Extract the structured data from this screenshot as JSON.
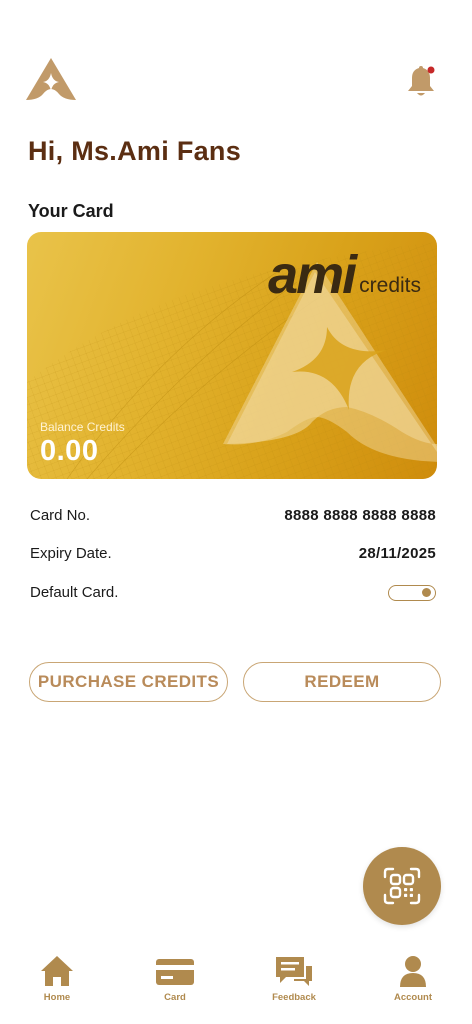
{
  "header": {
    "logo_icon": "ami-logo-icon",
    "notification_icon": "bell-icon",
    "notification_badge_color": "#c62828"
  },
  "greeting": "Hi, Ms.Ami Fans",
  "card_section": {
    "title": "Your Card"
  },
  "card": {
    "brand": "ami",
    "brand_suffix": "credits",
    "balance_label": "Balance Credits",
    "balance_value": "0.00"
  },
  "details": {
    "card_no_label": "Card No.",
    "card_no_value": "8888 8888 8888 8888",
    "expiry_label": "Expiry Date.",
    "expiry_value": "28/11/2025",
    "default_label": "Default Card.",
    "default_enabled": true
  },
  "actions": {
    "purchase_label": "PURCHASE CREDITS",
    "redeem_label": "REDEEM"
  },
  "fab": {
    "icon": "qr-scan-icon"
  },
  "nav": {
    "items": [
      {
        "label": "Home",
        "icon": "home-icon"
      },
      {
        "label": "Card",
        "icon": "card-icon"
      },
      {
        "label": "Feedback",
        "icon": "feedback-icon"
      },
      {
        "label": "Account",
        "icon": "account-icon"
      }
    ]
  },
  "colors": {
    "accent": "#b08a4e",
    "greeting": "#5b2e12",
    "card_gold": "#dcaa22"
  }
}
